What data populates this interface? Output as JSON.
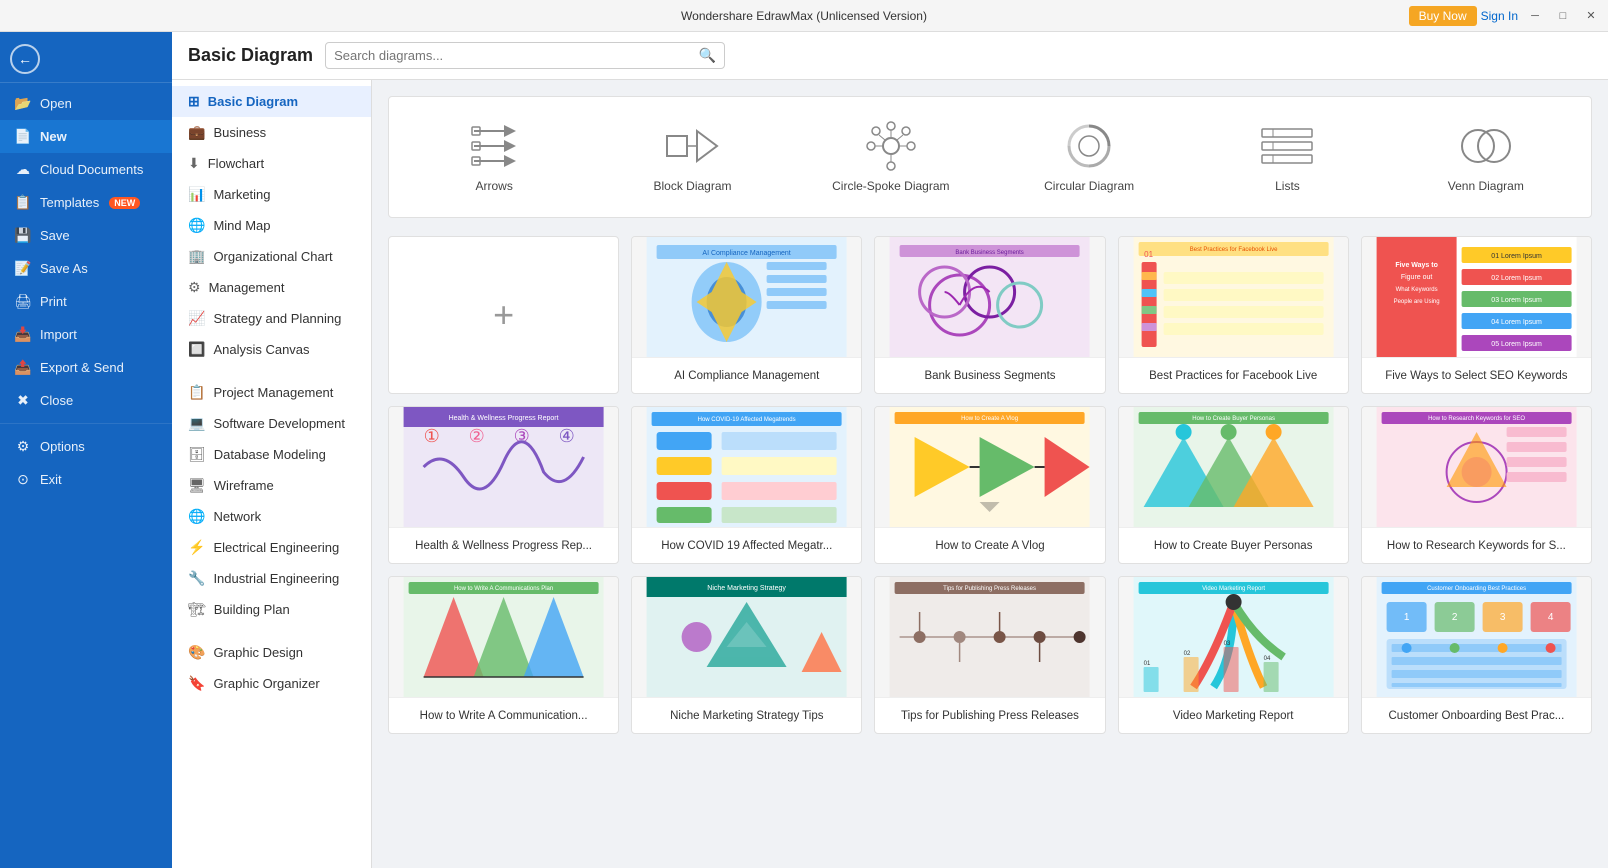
{
  "titleBar": {
    "title": "Wondershare EdrawMax (Unlicensed Version)",
    "minimize": "─",
    "maximize": "□",
    "close": "✕",
    "buyNow": "Buy Now",
    "signIn": "Sign In"
  },
  "sidebar": {
    "items": [
      {
        "id": "open",
        "label": "Open",
        "icon": "📂"
      },
      {
        "id": "new",
        "label": "New",
        "icon": "📄",
        "active": true
      },
      {
        "id": "cloud",
        "label": "Cloud Documents",
        "icon": "☁"
      },
      {
        "id": "templates",
        "label": "Templates",
        "icon": "📋",
        "badge": "NEW"
      },
      {
        "id": "save",
        "label": "Save",
        "icon": "💾"
      },
      {
        "id": "saveas",
        "label": "Save As",
        "icon": "📝"
      },
      {
        "id": "print",
        "label": "Print",
        "icon": "🖨"
      },
      {
        "id": "import",
        "label": "Import",
        "icon": "📥"
      },
      {
        "id": "export",
        "label": "Export & Send",
        "icon": "📤"
      },
      {
        "id": "close",
        "label": "Close",
        "icon": "✖"
      },
      {
        "id": "options",
        "label": "Options",
        "icon": "⚙"
      },
      {
        "id": "exit",
        "label": "Exit",
        "icon": "⊙"
      }
    ]
  },
  "subNav": {
    "items": [
      {
        "id": "basic",
        "label": "Basic Diagram",
        "active": true
      },
      {
        "id": "business",
        "label": "Business"
      },
      {
        "id": "flowchart",
        "label": "Flowchart"
      },
      {
        "id": "marketing",
        "label": "Marketing"
      },
      {
        "id": "mindmap",
        "label": "Mind Map"
      },
      {
        "id": "orgchart",
        "label": "Organizational Chart"
      },
      {
        "id": "management",
        "label": "Management"
      },
      {
        "id": "strategy",
        "label": "Strategy and Planning"
      },
      {
        "id": "analysis",
        "label": "Analysis Canvas"
      },
      {
        "id": "projectmgmt",
        "label": "Project Management"
      },
      {
        "id": "software",
        "label": "Software Development"
      },
      {
        "id": "database",
        "label": "Database Modeling"
      },
      {
        "id": "wireframe",
        "label": "Wireframe"
      },
      {
        "id": "network",
        "label": "Network"
      },
      {
        "id": "electrical",
        "label": "Electrical Engineering"
      },
      {
        "id": "industrial",
        "label": "Industrial Engineering"
      },
      {
        "id": "building",
        "label": "Building Plan"
      },
      {
        "id": "graphic",
        "label": "Graphic Design"
      },
      {
        "id": "organizer",
        "label": "Graphic Organizer"
      }
    ]
  },
  "header": {
    "title": "Basic Diagram",
    "searchPlaceholder": "Search diagrams..."
  },
  "iconCards": [
    {
      "id": "arrows",
      "label": "Arrows"
    },
    {
      "id": "block",
      "label": "Block Diagram"
    },
    {
      "id": "circle-spoke",
      "label": "Circle-Spoke Diagram"
    },
    {
      "id": "circular",
      "label": "Circular Diagram"
    },
    {
      "id": "lists",
      "label": "Lists"
    },
    {
      "id": "venn",
      "label": "Venn Diagram"
    }
  ],
  "templates": [
    {
      "id": "add-new",
      "label": "",
      "isAdd": true
    },
    {
      "id": "ai-compliance",
      "label": "AI Compliance Management",
      "color1": "#4fc3f7",
      "color2": "#81c784"
    },
    {
      "id": "bank-segments",
      "label": "Bank Business Segments",
      "color1": "#ce93d8",
      "color2": "#80cbc4"
    },
    {
      "id": "fb-live",
      "label": "Best Practices for Facebook Live",
      "color1": "#ffb74d",
      "color2": "#64b5f6"
    },
    {
      "id": "seo-keywords",
      "label": "Five Ways to Select SEO Keywords",
      "color1": "#ef5350",
      "color2": "#ffca28"
    },
    {
      "id": "health-wellness",
      "label": "Health & Wellness Progress Rep...",
      "color1": "#7e57c2",
      "color2": "#ef5350"
    },
    {
      "id": "covid19",
      "label": "How COVID 19 Affected Megatr...",
      "color1": "#42a5f5",
      "color2": "#ffca28"
    },
    {
      "id": "create-vlog",
      "label": "How to Create A Vlog",
      "color1": "#ffca28",
      "color2": "#ef5350"
    },
    {
      "id": "buyer-personas",
      "label": "How to Create Buyer Personas",
      "color1": "#66bb6a",
      "color2": "#26c6da"
    },
    {
      "id": "research-keywords",
      "label": "How to Research Keywords for S...",
      "color1": "#ab47bc",
      "color2": "#26a69a"
    },
    {
      "id": "communication-plan",
      "label": "How to Write A Communication...",
      "color1": "#ef5350",
      "color2": "#66bb6a"
    },
    {
      "id": "niche-marketing",
      "label": "Niche Marketing Strategy Tips",
      "color1": "#26a69a",
      "color2": "#ab47bc"
    },
    {
      "id": "press-releases",
      "label": "Tips for Publishing Press Releases",
      "color1": "#8d6e63",
      "color2": "#546e7a"
    },
    {
      "id": "video-report",
      "label": "Video Marketing Report",
      "color1": "#26c6da",
      "color2": "#ef5350"
    },
    {
      "id": "onboarding",
      "label": "Customer Onboarding Best Prac...",
      "color1": "#42a5f5",
      "color2": "#66bb6a"
    }
  ]
}
